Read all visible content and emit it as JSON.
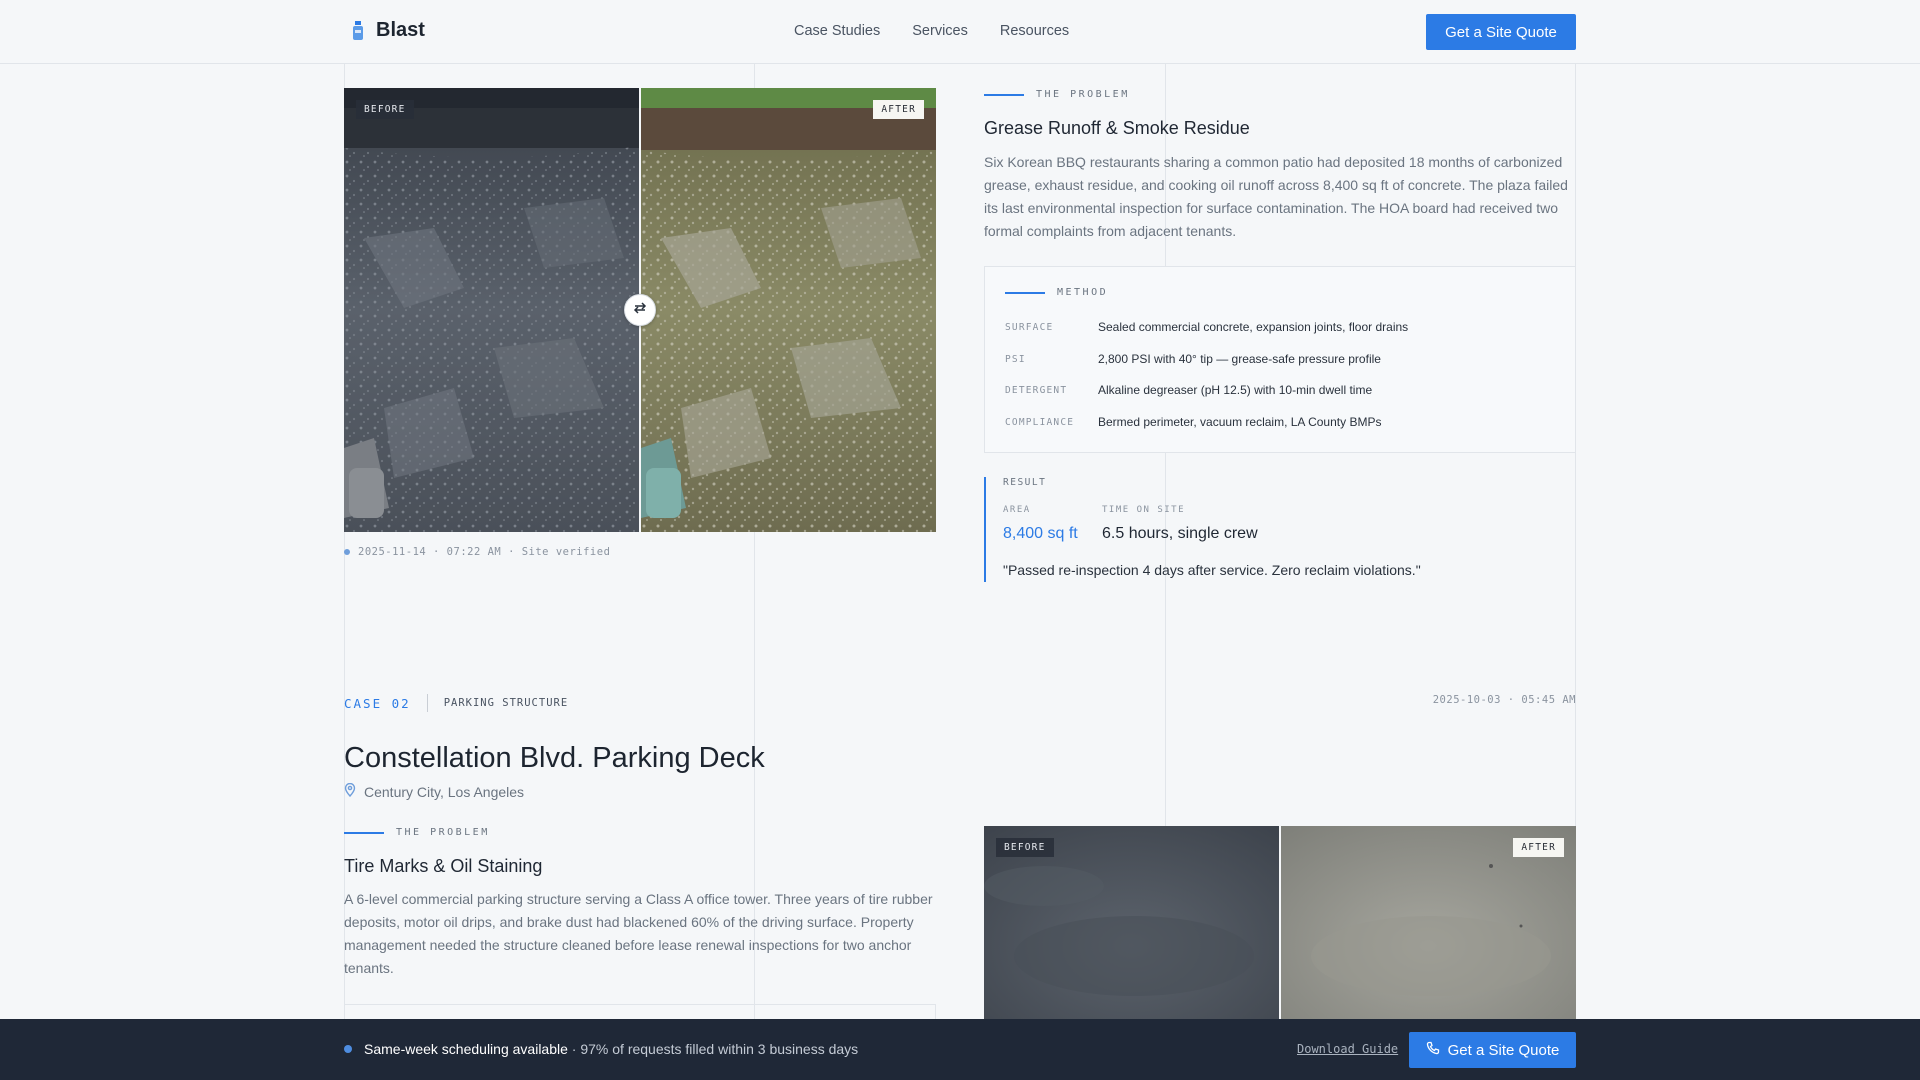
{
  "header": {
    "brand": "Blast",
    "nav": [
      "Case Studies",
      "Services",
      "Resources"
    ],
    "cta": "Get a Site Quote"
  },
  "case1": {
    "before_tag": "BEFORE",
    "after_tag": "AFTER",
    "caption": "2025-11-14 · 07:22 AM · Site verified",
    "problem_eyebrow": "THE PROBLEM",
    "problem_title": "Grease Runoff & Smoke Residue",
    "problem_text": "Six Korean BBQ restaurants sharing a common patio had deposited 18 months of carbonized grease, exhaust residue, and cooking oil runoff across 8,400 sq ft of concrete. The plaza failed its last environmental inspection for surface contamination. The HOA board had received two formal complaints from adjacent tenants.",
    "method_eyebrow": "METHOD",
    "method": [
      {
        "key": "SURFACE",
        "value": "Sealed commercial concrete, expansion joints, floor drains"
      },
      {
        "key": "PSI",
        "value": "2,800 PSI with 40° tip — grease-safe pressure profile"
      },
      {
        "key": "DETERGENT",
        "value": "Alkaline degreaser (pH 12.5) with 10-min dwell time"
      },
      {
        "key": "COMPLIANCE",
        "value": "Bermed perimeter, vacuum reclaim, LA County BMPs"
      }
    ],
    "result_label": "RESULT",
    "area_label": "AREA",
    "area_value": "8,400 sq ft",
    "time_label": "TIME ON SITE",
    "time_value": "6.5 hours, single crew",
    "quote": "\"Passed re-inspection 4 days after service. Zero reclaim violations.\""
  },
  "case2": {
    "case_num": "CASE 02",
    "case_type": "PARKING STRUCTURE",
    "timestamp": "2025-10-03 · 05:45 AM",
    "title": "Constellation Blvd. Parking Deck",
    "location": "Century City, Los Angeles",
    "problem_eyebrow": "THE PROBLEM",
    "problem_title": "Tire Marks & Oil Staining",
    "problem_text": "A 6-level commercial parking structure serving a Class A office tower. Three years of tire rubber deposits, motor oil drips, and brake dust had blackened 60% of the driving surface. Property management needed the structure cleaned before lease renewal inspections for two anchor tenants.",
    "before_tag": "BEFORE",
    "after_tag": "AFTER"
  },
  "footer": {
    "status_strong": "Same-week scheduling available",
    "status_rest": " · 97% of requests filled within 3 business days",
    "download": "Download Guide",
    "cta": "Get a Site Quote"
  },
  "colors": {
    "accent": "#2c7be5",
    "footer_bg": "#1f2837",
    "page_bg": "#f5f7f9"
  }
}
